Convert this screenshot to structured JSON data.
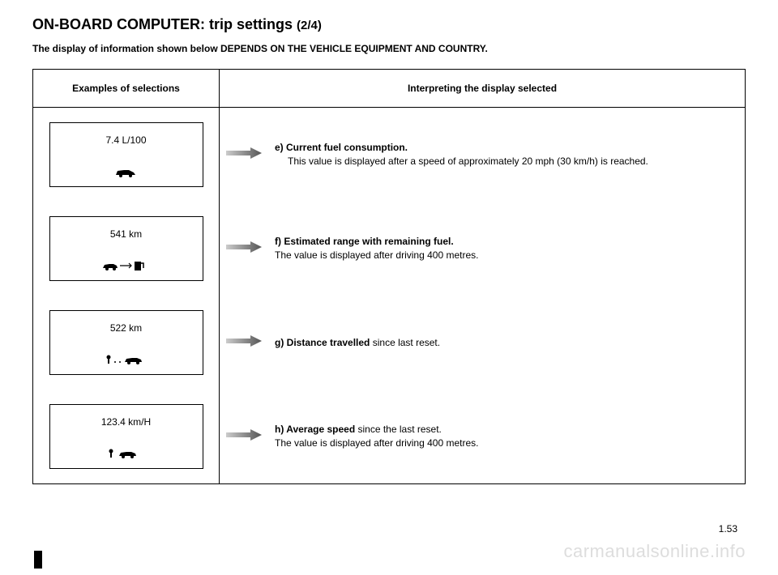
{
  "title_main": "ON-BOARD COMPUTER: trip settings",
  "title_part": "(2/4)",
  "subtitle": "The display of information shown below DEPENDS ON THE VEHICLE EQUIPMENT AND COUNTRY.",
  "header_left": "Examples of selections",
  "header_right": "Interpreting the display selected",
  "rows": [
    {
      "display_value": "7.4 L/100",
      "icon_hint": "car",
      "letter": "e)",
      "bold": "Current fuel consumption.",
      "text": "This value is displayed after a speed of approximately 20 mph (30 km/h) is reached."
    },
    {
      "display_value": "541 km",
      "icon_hint": "car-arrow-pump",
      "letter": "f)",
      "bold": " Estimated range with remaining fuel.",
      "text": "The value is displayed after driving 400 metres."
    },
    {
      "display_value": "522 km",
      "icon_hint": "pin-dots-car",
      "letter": "g)",
      "bold": "Distance travelled",
      "text": " since last reset."
    },
    {
      "display_value": "123.4 km/H",
      "icon_hint": "pin-car",
      "letter": "h)",
      "bold": "Average speed",
      "text": " since the last reset.",
      "text2": "The value is displayed after driving 400 metres."
    }
  ],
  "page_number": "1.53",
  "watermark": "carmanualsonline.info"
}
